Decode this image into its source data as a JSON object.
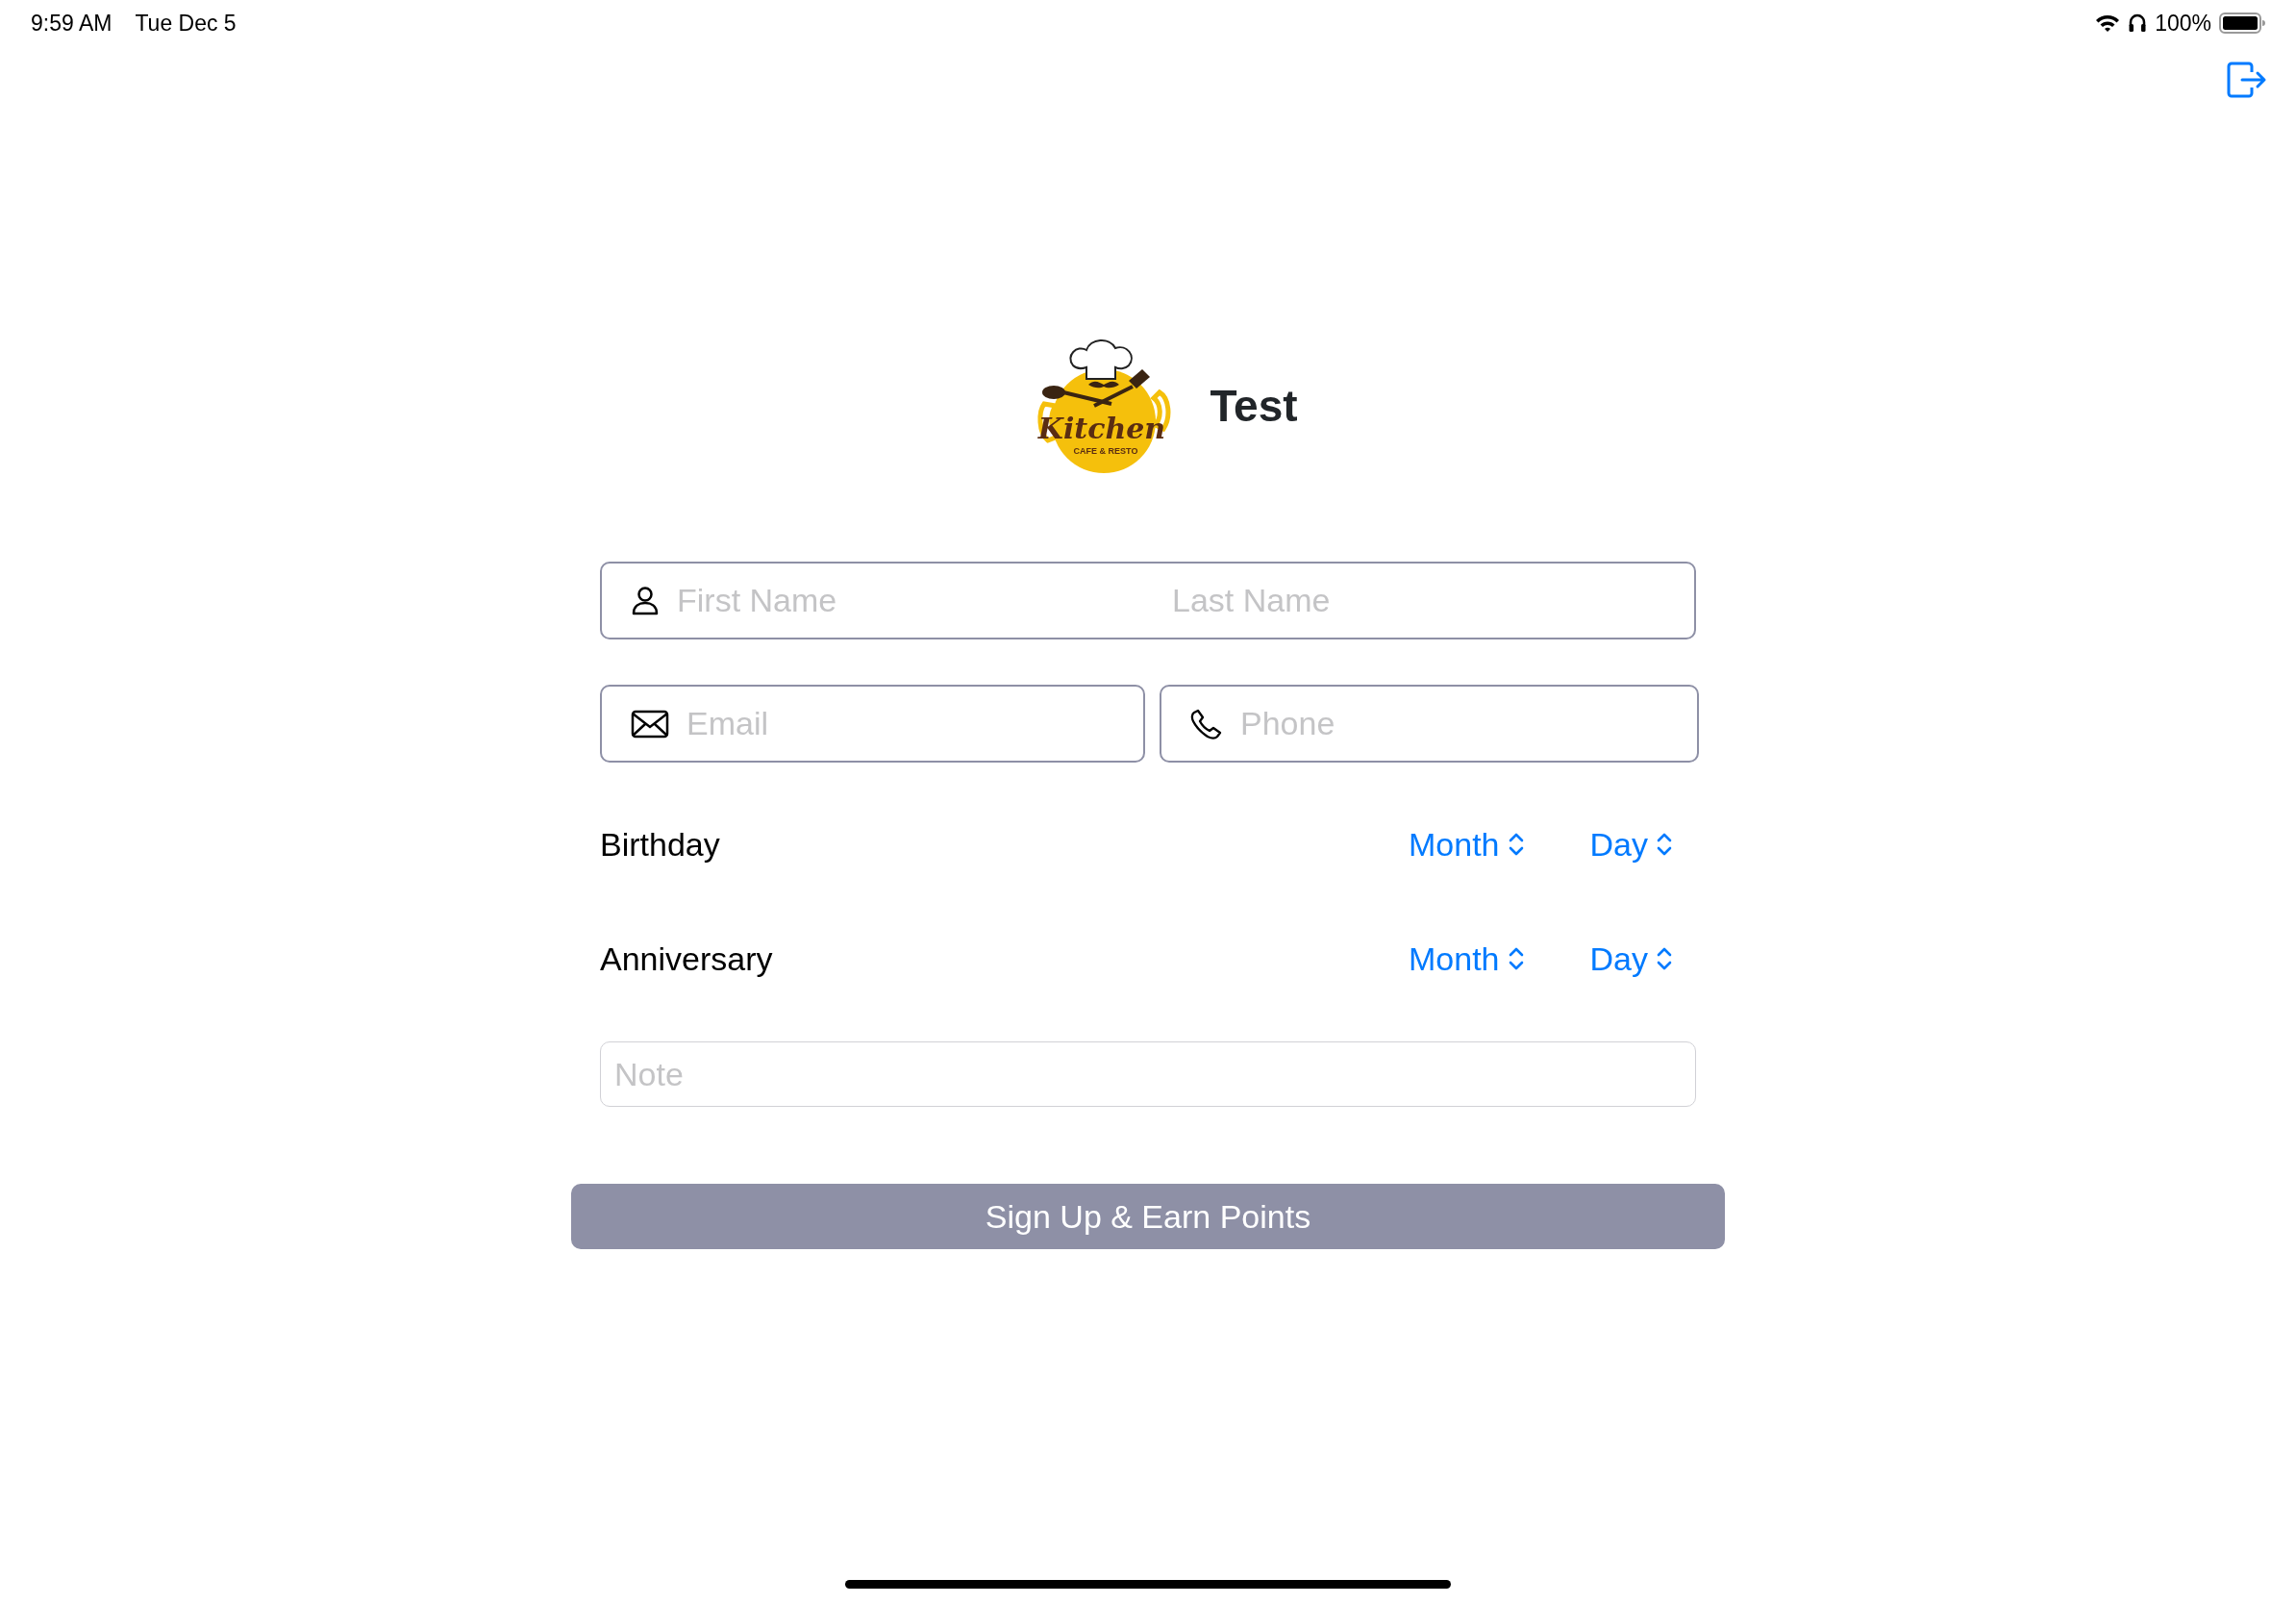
{
  "status_bar": {
    "time": "9:59 AM",
    "date": "Tue Dec 5",
    "battery": "100%"
  },
  "header": {
    "logo": {
      "wordmark": "Kitchen",
      "tagline": "CAFE & RESTO"
    },
    "title": "Test"
  },
  "name_field": {
    "first_placeholder": "First Name",
    "last_placeholder": "Last Name"
  },
  "email_field": {
    "placeholder": "Email"
  },
  "phone_field": {
    "placeholder": "Phone"
  },
  "date_rows": [
    {
      "label": "Birthday",
      "month": "Month",
      "day": "Day"
    },
    {
      "label": "Anniversary",
      "month": "Month",
      "day": "Day"
    }
  ],
  "note_field": {
    "placeholder": "Note"
  },
  "submit_button": {
    "label": "Sign Up & Earn Points",
    "disabled": true
  }
}
